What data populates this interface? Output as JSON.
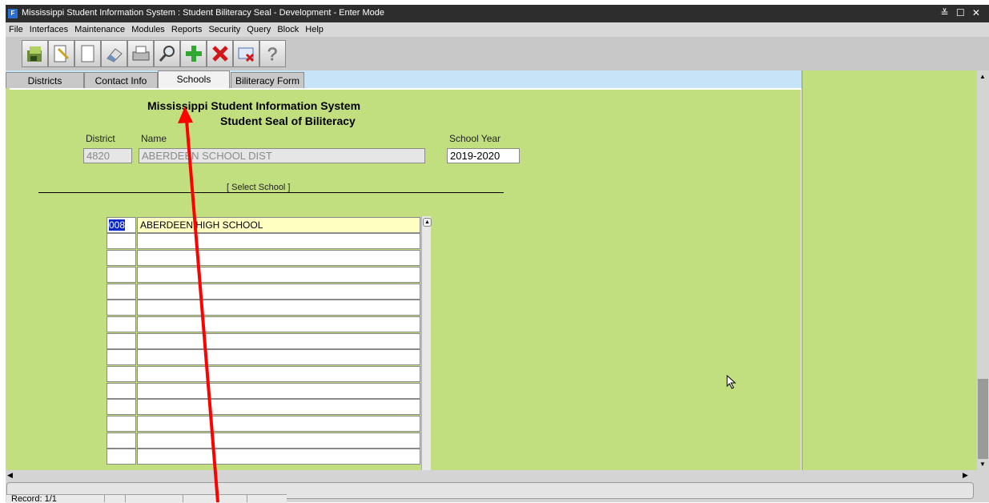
{
  "window": {
    "title": "Mississippi Student Information System : Student Biliteracy Seal  -  Development  -  Enter Mode",
    "controls": "≚ ☐ ✕"
  },
  "menu": [
    "File",
    "Interfaces",
    "Maintenance",
    "Modules",
    "Reports",
    "Security",
    "Query",
    "Block",
    "Help"
  ],
  "toolbar": {
    "icons": [
      "save-icon",
      "new-icon",
      "blank-page-icon",
      "eraser-icon",
      "print-icon",
      "search-icon",
      "add-icon",
      "delete-icon",
      "close-form-icon",
      "help-icon"
    ]
  },
  "tabs": [
    {
      "label": "Districts",
      "active": false
    },
    {
      "label": "Contact Info",
      "active": false
    },
    {
      "label": "Schools",
      "active": true
    },
    {
      "label": "Biliteracy Form",
      "active": false
    }
  ],
  "form": {
    "header_line1": "Mississippi Student Information System",
    "header_line2": "Student Seal of Biliteracy",
    "district_label": "District",
    "name_label": "Name",
    "school_year_label": "School Year",
    "district_value": "4820",
    "name_value": "ABERDEEN SCHOOL DIST",
    "school_year_value": "2019-2020",
    "select_school_label": "[ Select School ]"
  },
  "schools": [
    {
      "code": "008",
      "name": "ABERDEEN HIGH SCHOOL"
    },
    {
      "code": "",
      "name": ""
    },
    {
      "code": "",
      "name": ""
    },
    {
      "code": "",
      "name": ""
    },
    {
      "code": "",
      "name": ""
    },
    {
      "code": "",
      "name": ""
    },
    {
      "code": "",
      "name": ""
    },
    {
      "code": "",
      "name": ""
    },
    {
      "code": "",
      "name": ""
    },
    {
      "code": "",
      "name": ""
    },
    {
      "code": "",
      "name": ""
    },
    {
      "code": "",
      "name": ""
    },
    {
      "code": "",
      "name": ""
    },
    {
      "code": "",
      "name": ""
    },
    {
      "code": "",
      "name": ""
    }
  ],
  "status": {
    "record": "Record: 1/1"
  },
  "colors": {
    "canvas": "#c2df80",
    "tab_strip": "#c7e3f7",
    "annotation_arrow": "#ff0000",
    "selection": "#0a28c8"
  }
}
